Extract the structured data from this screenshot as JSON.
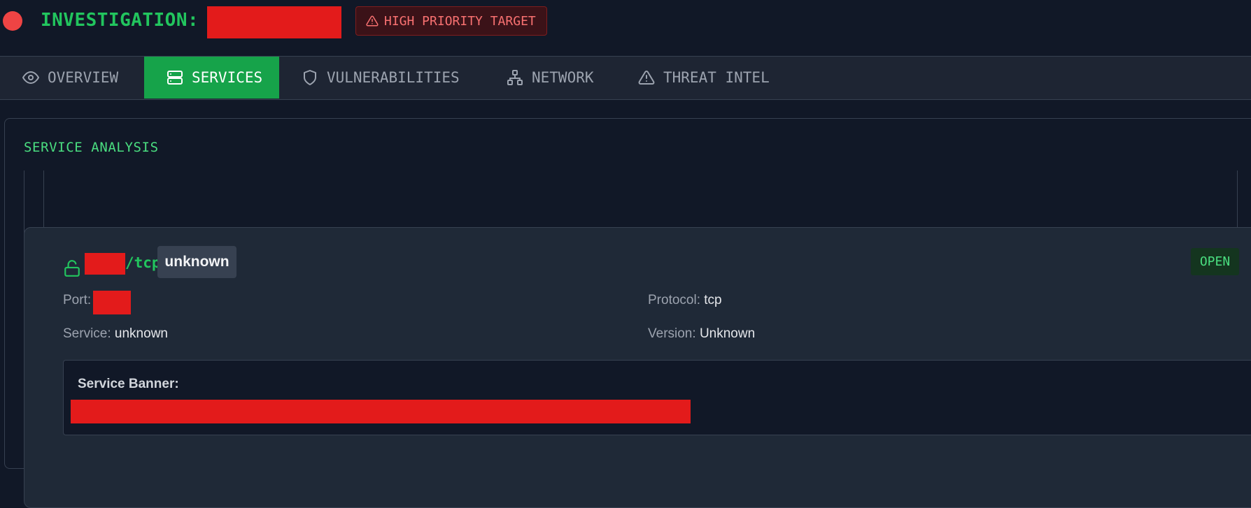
{
  "header": {
    "title": "INVESTIGATION:",
    "priority_badge": "HIGH PRIORITY TARGET"
  },
  "tabs": [
    {
      "label": "OVERVIEW",
      "icon": "eye-icon",
      "active": false
    },
    {
      "label": "SERVICES",
      "icon": "server-icon",
      "active": true
    },
    {
      "label": "VULNERABILITIES",
      "icon": "shield-icon",
      "active": false
    },
    {
      "label": "NETWORK",
      "icon": "network-icon",
      "active": false
    },
    {
      "label": "THREAT INTEL",
      "icon": "warning-icon",
      "active": false
    }
  ],
  "panel": {
    "title": "SERVICE ANALYSIS"
  },
  "service": {
    "proto_suffix": "/tcp",
    "name_badge": "unknown",
    "state": "OPEN",
    "port_label": "Port:",
    "service_label": "Service:",
    "service_value": "unknown",
    "protocol_label": "Protocol:",
    "protocol_value": "tcp",
    "version_label": "Version:",
    "version_value": "Unknown",
    "banner_label": "Service Banner:"
  },
  "colors": {
    "accent": "#22c55e",
    "danger": "#ef4444",
    "redaction": "#e31b1b",
    "background": "#111827"
  }
}
